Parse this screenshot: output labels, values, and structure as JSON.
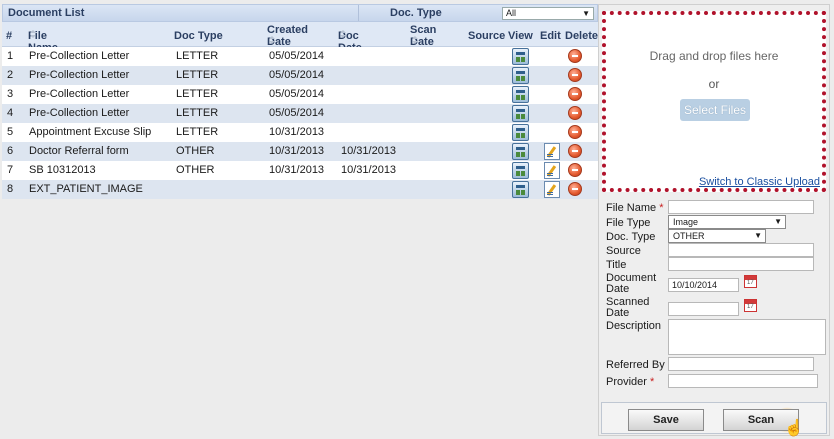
{
  "document_list": {
    "title": "Document List",
    "doc_type_label": "Doc. Type",
    "doc_type_value": "All",
    "columns": {
      "num": "#",
      "file_name": "File Name",
      "doc_type": "Doc Type",
      "created_date": "Created Date",
      "doc_date": "Doc Date",
      "scan_date": "Scan Date",
      "source": "Source",
      "view": "View",
      "edit": "Edit",
      "delete": "Delete"
    },
    "rows": [
      {
        "num": "1",
        "file_name": "Pre-Collection Letter",
        "doc_type": "LETTER",
        "created_date": "05/05/2014",
        "doc_date": "",
        "edit": false
      },
      {
        "num": "2",
        "file_name": "Pre-Collection Letter",
        "doc_type": "LETTER",
        "created_date": "05/05/2014",
        "doc_date": "",
        "edit": false
      },
      {
        "num": "3",
        "file_name": "Pre-Collection Letter",
        "doc_type": "LETTER",
        "created_date": "05/05/2014",
        "doc_date": "",
        "edit": false
      },
      {
        "num": "4",
        "file_name": "Pre-Collection Letter",
        "doc_type": "LETTER",
        "created_date": "05/05/2014",
        "doc_date": "",
        "edit": false
      },
      {
        "num": "5",
        "file_name": "Appointment Excuse Slip",
        "doc_type": "LETTER",
        "created_date": "10/31/2013",
        "doc_date": "",
        "edit": false
      },
      {
        "num": "6",
        "file_name": "Doctor Referral form",
        "doc_type": "OTHER",
        "created_date": "10/31/2013",
        "doc_date": "10/31/2013",
        "edit": true
      },
      {
        "num": "7",
        "file_name": "SB 10312013",
        "doc_type": "OTHER",
        "created_date": "10/31/2013",
        "doc_date": "10/31/2013",
        "edit": true
      },
      {
        "num": "8",
        "file_name": "EXT_PATIENT_IMAGE",
        "doc_type": "",
        "created_date": "",
        "doc_date": "",
        "edit": true
      }
    ]
  },
  "upload": {
    "drag_text": "Drag and drop files here",
    "or_text": "or",
    "select_button": "Select Files",
    "classic_link": "Switch to Classic Upload"
  },
  "form": {
    "file_name_label": "File Name",
    "required_mark": "*",
    "file_type_label": "File Type",
    "file_type_value": "Image",
    "doc_type_label": "Doc. Type",
    "doc_type_value": "OTHER",
    "source_label": "Source",
    "title_label": "Title",
    "document_date_label_1": "Document",
    "document_date_label_2": "Date",
    "document_date_value": "10/10/2014",
    "scanned_date_label_1": "Scanned",
    "scanned_date_label_2": "Date",
    "description_label": "Description",
    "referred_by_label": "Referred By",
    "provider_label": "Provider"
  },
  "buttons": {
    "save": "Save",
    "scan": "Scan"
  },
  "dropdown_arrow": "▼"
}
